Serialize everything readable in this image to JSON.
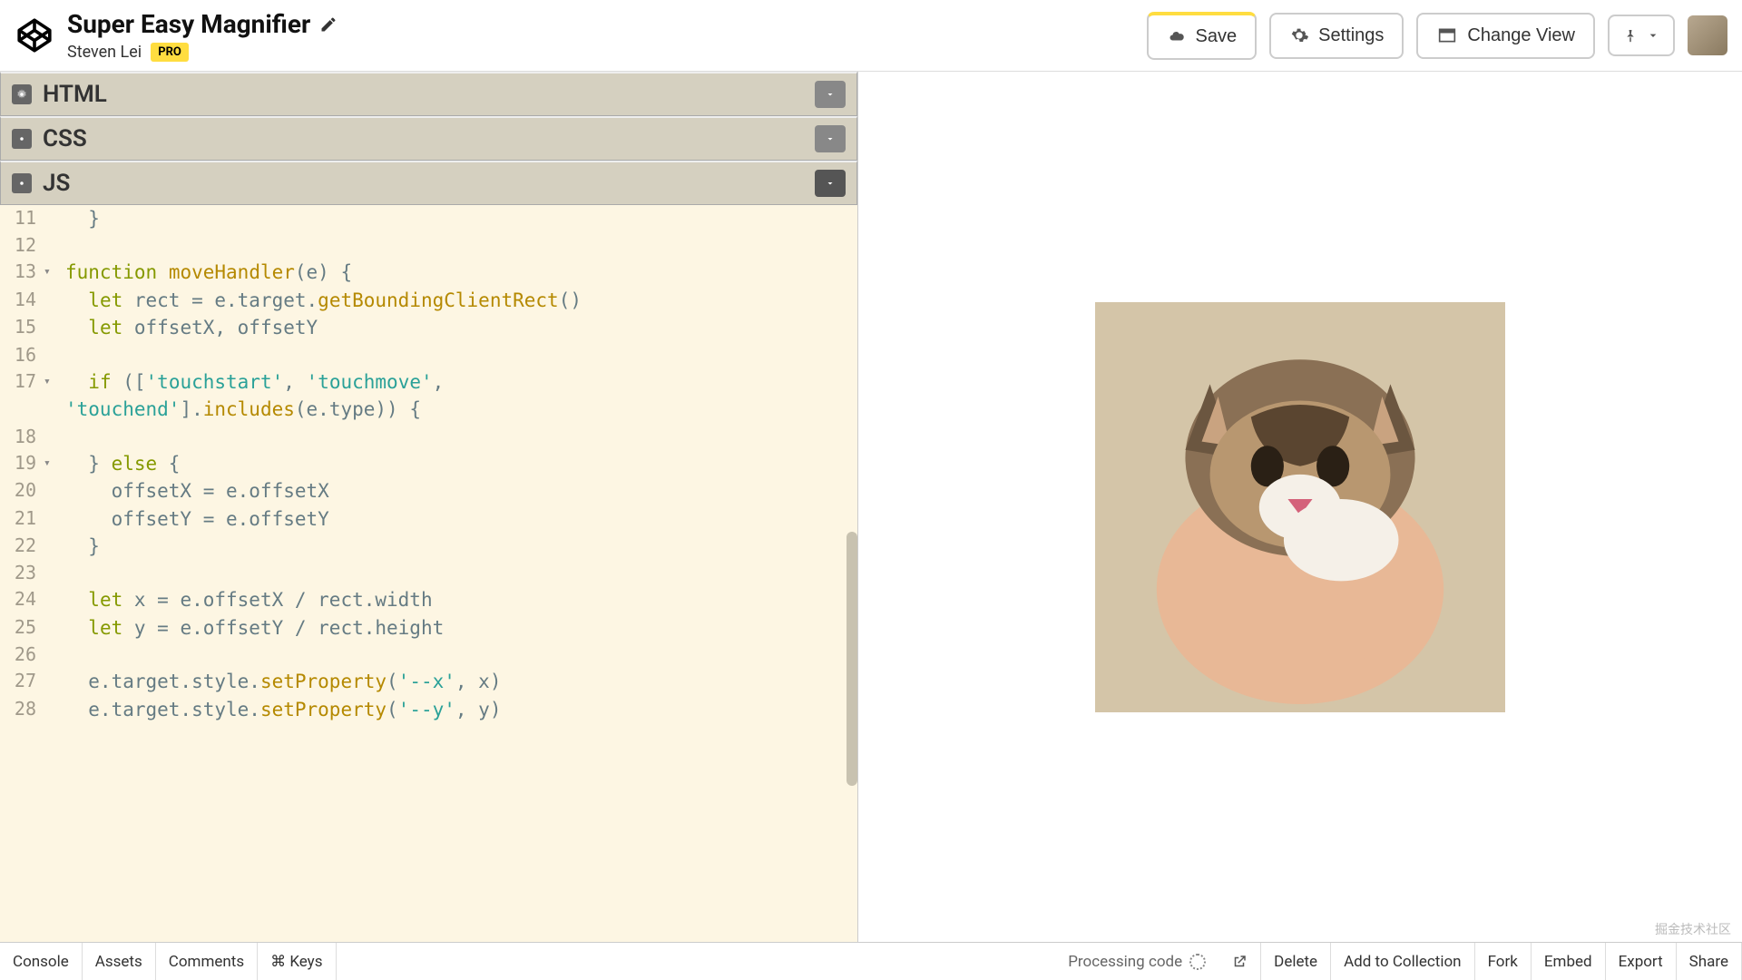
{
  "header": {
    "title": "Super Easy Magnifier",
    "author": "Steven Lei",
    "pro": "PRO",
    "save": "Save",
    "settings": "Settings",
    "changeView": "Change View"
  },
  "panels": {
    "html": "HTML",
    "css": "CSS",
    "js": "JS"
  },
  "code": {
    "lines": [
      {
        "n": "11",
        "fold": "",
        "html": "  }"
      },
      {
        "n": "12",
        "fold": "",
        "html": ""
      },
      {
        "n": "13",
        "fold": "▾",
        "html": "<span class='kw'>function</span> <span class='fn'>moveHandler</span>(e) {"
      },
      {
        "n": "14",
        "fold": "",
        "html": "  <span class='kw'>let</span> rect = e.target.<span class='fn'>getBoundingClientRect</span>()"
      },
      {
        "n": "15",
        "fold": "",
        "html": "  <span class='kw'>let</span> offsetX, offsetY"
      },
      {
        "n": "16",
        "fold": "",
        "html": ""
      },
      {
        "n": "17",
        "fold": "▾",
        "html": "  <span class='kw'>if</span> ([<span class='str'>'touchstart'</span>, <span class='str'>'touchmove'</span>, "
      },
      {
        "n": "",
        "fold": "",
        "html": "<span class='str'>'touchend'</span>].<span class='fn'>includes</span>(e.type)) {"
      },
      {
        "n": "18",
        "fold": "",
        "html": ""
      },
      {
        "n": "19",
        "fold": "▾",
        "html": "  } <span class='kw'>else</span> {"
      },
      {
        "n": "20",
        "fold": "",
        "html": "    offsetX = e.offsetX"
      },
      {
        "n": "21",
        "fold": "",
        "html": "    offsetY = e.offsetY"
      },
      {
        "n": "22",
        "fold": "",
        "html": "  }"
      },
      {
        "n": "23",
        "fold": "",
        "html": ""
      },
      {
        "n": "24",
        "fold": "",
        "html": "  <span class='kw'>let</span> x = e.offsetX / rect.width"
      },
      {
        "n": "25",
        "fold": "",
        "html": "  <span class='kw'>let</span> y = e.offsetY / rect.height"
      },
      {
        "n": "26",
        "fold": "",
        "html": ""
      },
      {
        "n": "27",
        "fold": "",
        "html": "  e.target.style.<span class='fn'>setProperty</span>(<span class='str'>'--x'</span>, x)"
      },
      {
        "n": "28",
        "fold": "",
        "html": "  e.target.style.<span class='fn'>setProperty</span>(<span class='str'>'--y'</span>, y)"
      }
    ]
  },
  "footer": {
    "console": "Console",
    "assets": "Assets",
    "comments": "Comments",
    "keys": "⌘ Keys",
    "processing": "Processing code",
    "delete": "Delete",
    "addCollection": "Add to Collection",
    "fork": "Fork",
    "embed": "Embed",
    "export": "Export",
    "share": "Share"
  },
  "watermark": "掘金技术社区"
}
